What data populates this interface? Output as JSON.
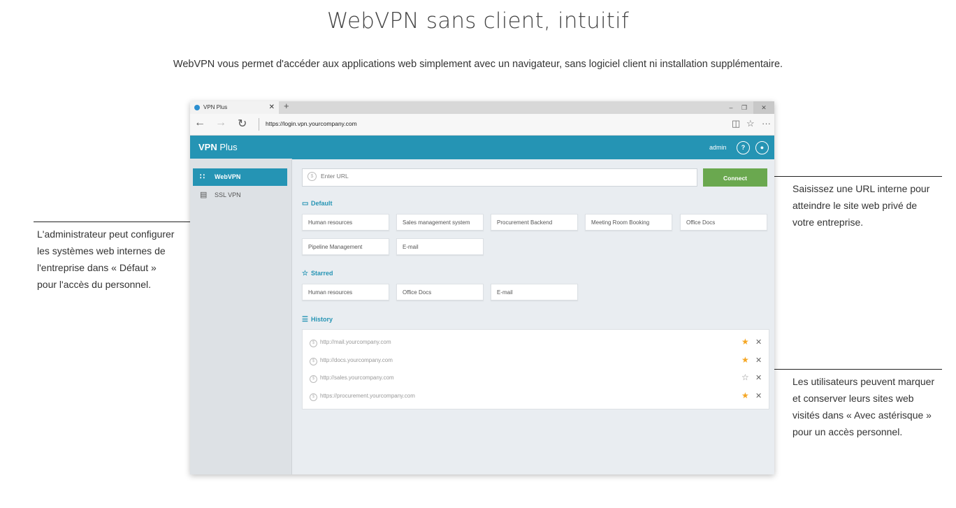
{
  "page": {
    "title": "WebVPN sans client, intuitif",
    "subtitle": "WebVPN vous permet d'accéder aux applications web simplement avec un navigateur, sans logiciel client ni installation supplémentaire.",
    "callout_left": [
      "L'administrateur peut configurer",
      "les systèmes web internes de",
      "l'entreprise dans « Défaut »",
      "pour l'accès du personnel."
    ],
    "callout_right_top": [
      "Saisissez une URL interne pour",
      "atteindre le site web privé de",
      "votre entreprise."
    ],
    "callout_right_bottom": [
      "Les utilisateurs peuvent marquer",
      "et conserver leurs sites web",
      "visités dans « Avec astérisque »",
      "pour un accès personnel."
    ]
  },
  "browser": {
    "tab_title": "VPN Plus",
    "tab_close": "✕",
    "new_tab": "+",
    "url": "https://login.vpn.yourcompany.com",
    "more": "···"
  },
  "app": {
    "brand_bold": "VPN",
    "brand_rest": " Plus",
    "user": "admin",
    "help": "?",
    "sidebar": [
      {
        "label": "WebVPN",
        "icon": "grid-icon",
        "active": true
      },
      {
        "label": "SSL VPN",
        "icon": "network-icon",
        "active": false
      }
    ],
    "url_placeholder": "Enter URL",
    "connect_label": "Connect",
    "default_label": "Default",
    "default_items": [
      "Human resources",
      "Sales management system",
      "Procurement Backend",
      "Meeting Room Booking",
      "Office Docs",
      "Pipeline Management",
      "E-mail"
    ],
    "starred_label": "Starred",
    "starred_items": [
      "Human resources",
      "Office Docs",
      "E-mail"
    ],
    "history_label": "History",
    "history": [
      {
        "url": "http://mail.yourcompany.com",
        "starred": true
      },
      {
        "url": "http://docs.yourcompany.com",
        "starred": true
      },
      {
        "url": "http://sales.yourcompany.com",
        "starred": false
      },
      {
        "url": "https://procurement.yourcompany.com",
        "starred": true
      }
    ],
    "colors": {
      "accent": "#2594b4",
      "connect": "#6aa84f",
      "star": "#f5a623"
    }
  }
}
